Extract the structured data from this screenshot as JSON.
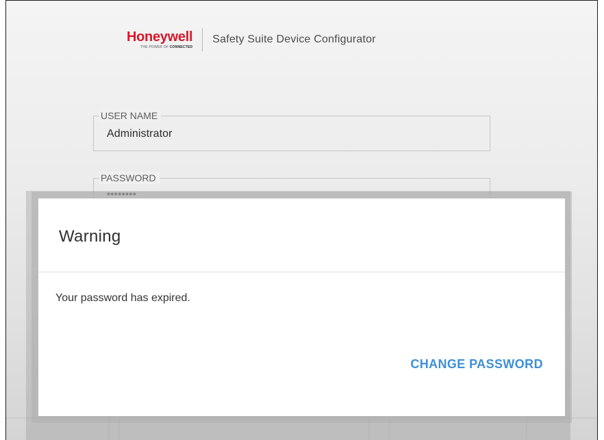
{
  "brand": {
    "logo_text": "Honeywell",
    "logo_tagline_prefix": "THE POWER OF",
    "logo_tagline_bold": "CONNECTED",
    "app_title": "Safety Suite Device Configurator"
  },
  "login": {
    "username": {
      "label": "USER NAME",
      "value": "Administrator"
    },
    "password": {
      "label": "PASSWORD",
      "value": "••••••••"
    }
  },
  "dialog": {
    "title": "Warning",
    "message": "Your password has expired.",
    "action_label": "CHANGE PASSWORD"
  },
  "colors": {
    "brand_red": "#d7182a",
    "action_blue": "#3d8fd6"
  }
}
